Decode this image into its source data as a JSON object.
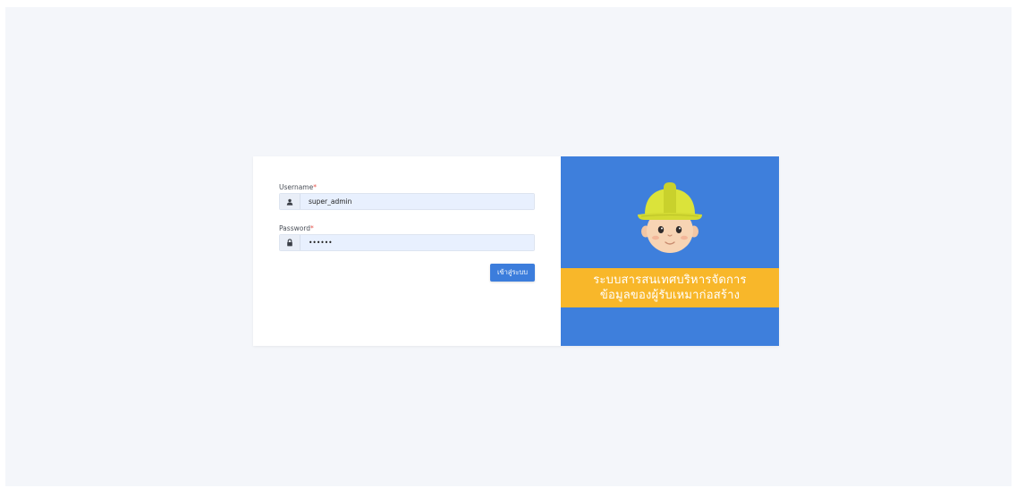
{
  "login": {
    "username_label": "Username",
    "password_label": "Password",
    "required_mark": "*",
    "username_value": "super_admin",
    "password_value": "••••••",
    "submit_label": "เข้าสู่ระบบ"
  },
  "brand": {
    "title_line1": "ระบบสารสนเทศบริหารจัดการ",
    "title_line2": "ข้อมูลของผู้รับเหมาก่อสร้าง"
  },
  "colors": {
    "page_background": "#f4f6fa",
    "brand_blue": "#3e7fdc",
    "banner_yellow": "#f8b72a",
    "button_blue": "#3c7ddc",
    "required_red": "#e5534b"
  },
  "icons": {
    "username": "user-icon",
    "password": "lock-icon",
    "mascot": "construction-worker-icon"
  }
}
